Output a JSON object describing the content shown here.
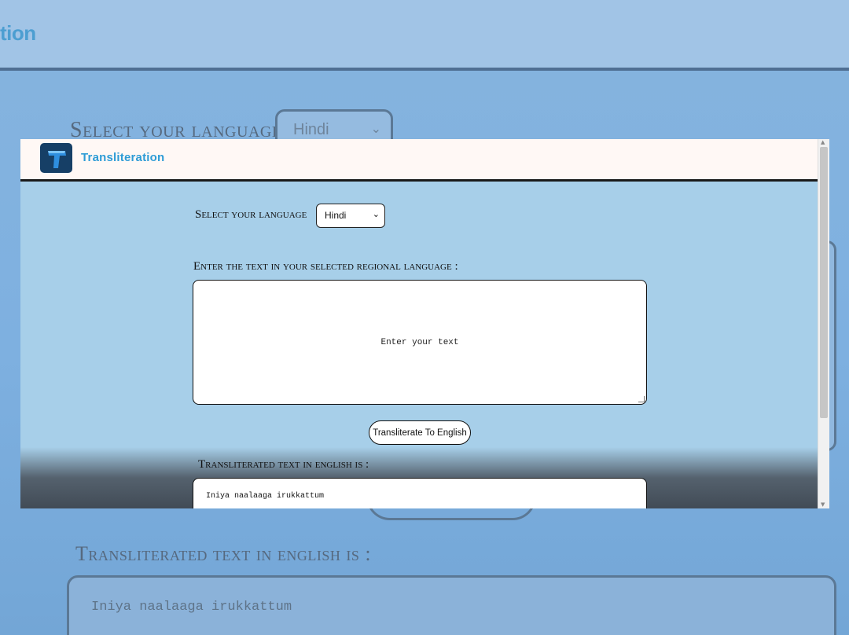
{
  "background": {
    "logo_fragment": "tion",
    "select_label": "Select your language",
    "select_value": "Hindi",
    "output_label": "Transliterated text in english is :",
    "output_text": "Iniya naalaaga irukkattum"
  },
  "header": {
    "logo_icon": "letter-t-icon",
    "app_name": "Transliteration"
  },
  "form": {
    "language_label": "Select your language",
    "language_value": "Hindi",
    "input_label": "Enter the text in your selected regional language :",
    "input_placeholder": "Enter your text",
    "submit_label": "Transliterate To English",
    "output_label": "Transliterated text in english is :",
    "output_text": "Iniya naalaaga irukkattum"
  },
  "colors": {
    "accent": "#2e9cd6",
    "logo_badge": "#163f66",
    "page_bg": "#a7cfe9"
  }
}
